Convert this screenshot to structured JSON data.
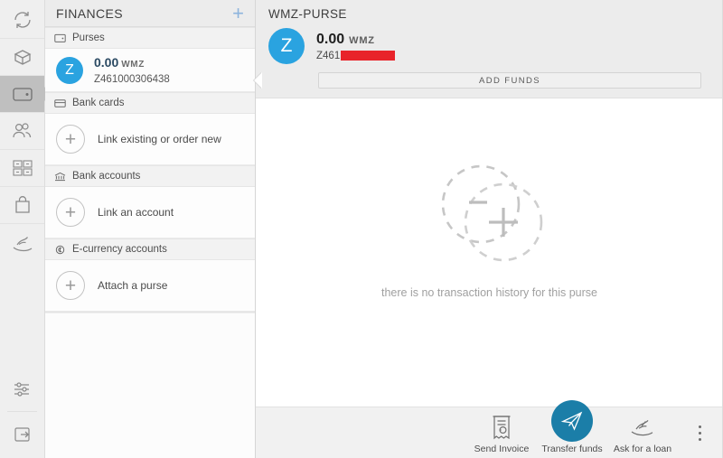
{
  "rail": {
    "items": [
      {
        "name": "exchange-icon",
        "label": "Exchange"
      },
      {
        "name": "package-icon",
        "label": "Parcels"
      },
      {
        "name": "wallet-icon",
        "label": "Finances",
        "active": true
      },
      {
        "name": "people-icon",
        "label": "Contacts"
      },
      {
        "name": "apps-grid-icon",
        "label": "Services"
      },
      {
        "name": "shopping-bag-icon",
        "label": "Shop"
      },
      {
        "name": "loan-hand-icon",
        "label": "Loans"
      }
    ],
    "bottom": [
      {
        "name": "settings-sliders-icon",
        "label": "Settings"
      },
      {
        "name": "logout-icon",
        "label": "Sign out"
      }
    ]
  },
  "finances": {
    "title": "FINANCES",
    "add_label": "+",
    "sections": [
      {
        "icon": "purse-icon",
        "header": "Purses",
        "purse": {
          "avatar_letter": "Z",
          "amount": "0.00",
          "currency": "WMZ",
          "number": "Z461000306438"
        }
      },
      {
        "icon": "bank-card-icon",
        "header": "Bank cards",
        "action": "Link existing or order new"
      },
      {
        "icon": "bank-icon",
        "header": "Bank accounts",
        "action": "Link an account"
      },
      {
        "icon": "e-currency-icon",
        "header": "E-currency accounts",
        "action": "Attach a purse"
      }
    ]
  },
  "main": {
    "title": "WMZ-PURSE",
    "purse": {
      "avatar_letter": "Z",
      "amount": "0.00",
      "currency": "WMZ",
      "number_visible": "Z461",
      "number_redacted": true
    },
    "add_funds_label": "ADD FUNDS",
    "empty_state": {
      "text": "there is no transaction history for this purse",
      "illustration": "minus-plus-circles-icon"
    },
    "footer": {
      "actions": [
        {
          "icon": "invoice-icon",
          "label": "Send Invoice",
          "highlight": false
        },
        {
          "icon": "paper-plane-icon",
          "label": "Transfer funds",
          "highlight": true
        },
        {
          "icon": "loan-hand-icon",
          "label": "Ask for a loan",
          "highlight": false
        }
      ],
      "more_menu": "more-vertical-icon"
    }
  },
  "colors": {
    "accent_blue": "#2aa3e0",
    "action_blue": "#1b7ea8",
    "redaction_red": "#e8232a",
    "rail_bg": "#efefef",
    "panel_header_bg": "#ececec"
  }
}
